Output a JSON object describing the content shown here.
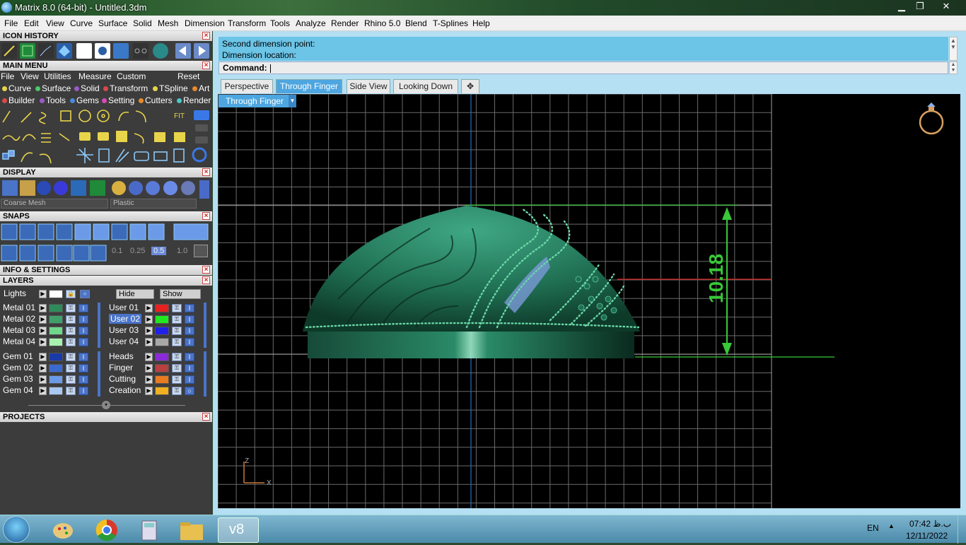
{
  "window": {
    "title": "Matrix 8.0 (64-bit) - Untitled.3dm",
    "controls": {
      "minimize": "▁",
      "maximize": "❐",
      "close": "✕"
    }
  },
  "menubar": [
    "File",
    "Edit",
    "View",
    "Curve",
    "Surface",
    "Solid",
    "Mesh",
    "Dimension",
    "Transform",
    "Tools",
    "Analyze",
    "Render",
    "Rhino 5.0",
    "Blend",
    "T-Splines",
    "Help"
  ],
  "icon_history": {
    "title": "ICON HISTORY"
  },
  "main_menu": {
    "title": "MAIN MENU",
    "menu": [
      "File",
      "View",
      "Utilities",
      "Measure",
      "Custom"
    ],
    "reset": "Reset",
    "categories_row1": [
      {
        "label": "Curve",
        "color": "#e8d44a"
      },
      {
        "label": "Surface",
        "color": "#4ac86a"
      },
      {
        "label": "Solid",
        "color": "#9a5ac8"
      },
      {
        "label": "Transform",
        "color": "#d84a4a"
      },
      {
        "label": "TSpline",
        "color": "#e8d44a"
      },
      {
        "label": "Art",
        "color": "#e88a2a"
      }
    ],
    "categories_row2": [
      {
        "label": "Builder",
        "color": "#d84a4a"
      },
      {
        "label": "Tools",
        "color": "#9a5ac8"
      },
      {
        "label": "Gems",
        "color": "#4a8ad8"
      },
      {
        "label": "Setting",
        "color": "#d84ab8"
      },
      {
        "label": "Cutters",
        "color": "#e88a2a"
      },
      {
        "label": "Render",
        "color": "#4ac8c8"
      }
    ]
  },
  "display": {
    "title": "DISPLAY",
    "mesh": "Coarse Mesh",
    "material": "Plastic"
  },
  "snaps": {
    "title": "SNAPS",
    "values": [
      "0.1",
      "0.25",
      "0.5",
      "1.0"
    ],
    "selected": "0.5"
  },
  "info_settings": {
    "title": "INFO & SETTINGS"
  },
  "layers": {
    "title": "LAYERS",
    "lights": "Lights",
    "hide": "Hide",
    "show": "Show",
    "left": [
      {
        "label": "Metal 01",
        "color": "#2f8a5a"
      },
      {
        "label": "Metal 02",
        "color": "#3fa06a"
      },
      {
        "label": "Metal 03",
        "color": "#6fd88a"
      },
      {
        "label": "Metal 04",
        "color": "#a8f0b0"
      },
      {
        "label": "Gem 01",
        "color": "#1a3aa8"
      },
      {
        "label": "Gem 02",
        "color": "#3a6ad0"
      },
      {
        "label": "Gem 03",
        "color": "#6a9ae8"
      },
      {
        "label": "Gem 04",
        "color": "#a8c8f0"
      }
    ],
    "right": [
      {
        "label": "User 01",
        "color": "#e82020"
      },
      {
        "label": "User 02",
        "color": "#20e820"
      },
      {
        "label": "User 03",
        "color": "#2020e8"
      },
      {
        "label": "User 04",
        "color": "#a8a8a8"
      },
      {
        "label": "Heads",
        "color": "#8a2ad8"
      },
      {
        "label": "Finger",
        "color": "#b84040"
      },
      {
        "label": "Cutting",
        "color": "#e87a20"
      },
      {
        "label": "Creation",
        "color": "#f0b020"
      }
    ],
    "highlighted": "User 02"
  },
  "projects": {
    "title": "PROJECTS"
  },
  "command": {
    "line1": "Second dimension point:",
    "line2": "Dimension location:",
    "prompt": "Command:"
  },
  "tabs": [
    {
      "label": "Perspective",
      "active": false
    },
    {
      "label": "Through Finger",
      "active": true
    },
    {
      "label": "Side View",
      "active": false
    },
    {
      "label": "Looking Down",
      "active": false
    },
    {
      "label": "✥",
      "active": false
    }
  ],
  "viewport": {
    "name": "Through Finger",
    "dimension": "10.18",
    "axis_z": "Z",
    "axis_x": "X"
  },
  "taskbar": {
    "lang": "EN",
    "time": "07:42 ب.ظ",
    "date": "12/11/2022",
    "active_app": "v8"
  }
}
